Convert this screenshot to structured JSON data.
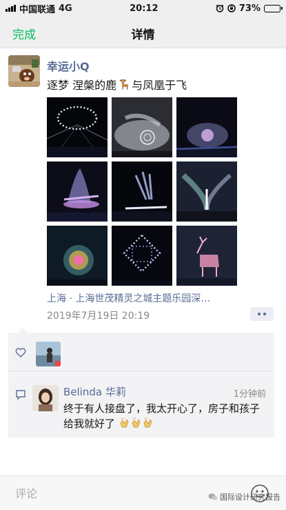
{
  "status_bar": {
    "carrier": "中国联通",
    "network": "4G",
    "time": "20:12",
    "battery": "73%",
    "battery_level": 0.73
  },
  "nav": {
    "back_label": "完成",
    "title": "详情"
  },
  "post": {
    "username": "幸运小Q",
    "text_before": "逐梦 涅槃的鹿",
    "text_after": "与凤凰于飞",
    "emoji": "deer-emoji",
    "location": "上海 · 上海世茂精灵之城主题乐园深…",
    "timestamp": "2019年7月19日 20:19",
    "photo_count": 9
  },
  "likes": {
    "icon": "heart-icon"
  },
  "comments": [
    {
      "name": "Belinda 华莉",
      "time": "1分钟前",
      "text": "终于有人接盘了，我太开心了，房子和孩子给我就好了",
      "emoji": "clap-emoji",
      "emoji_count": 3
    }
  ],
  "input": {
    "placeholder": "评论"
  },
  "watermark": {
    "text": "国际设计研究报告"
  },
  "colors": {
    "accent_green": "#07c160",
    "link_blue": "#576b95"
  }
}
